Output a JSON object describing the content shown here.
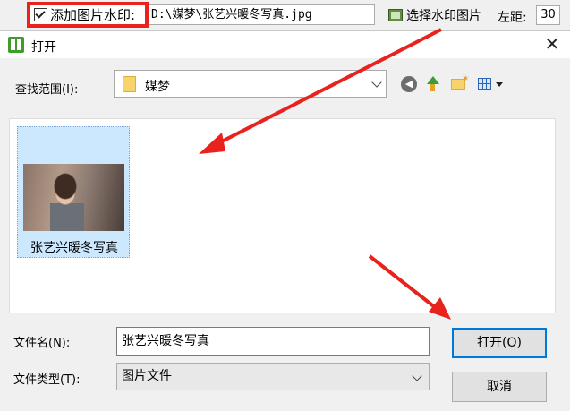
{
  "toolbar": {
    "add_watermark_label": "添加图片水印:",
    "watermark_path": "D:\\媒梦\\张艺兴暖冬写真.jpg",
    "select_watermark_label": "选择水印图片",
    "left_margin_label": "左距:",
    "left_margin_value": "30"
  },
  "dialog": {
    "title": "打开",
    "close_glyph": "✕",
    "look_in_label": "查找范围(I):",
    "look_in_value": "媒梦",
    "back_glyph": "◀",
    "files": [
      {
        "name": "张艺兴暖冬写真"
      }
    ],
    "filename_label": "文件名(N):",
    "filename_value": "张艺兴暖冬写真",
    "filetype_label": "文件类型(T):",
    "filetype_value": "图片文件",
    "open_button": "打开(O)",
    "cancel_button": "取消"
  },
  "colors": {
    "annotation_red": "#e8231e",
    "selection_blue": "#cce8ff",
    "default_button_border": "#0078d7"
  }
}
